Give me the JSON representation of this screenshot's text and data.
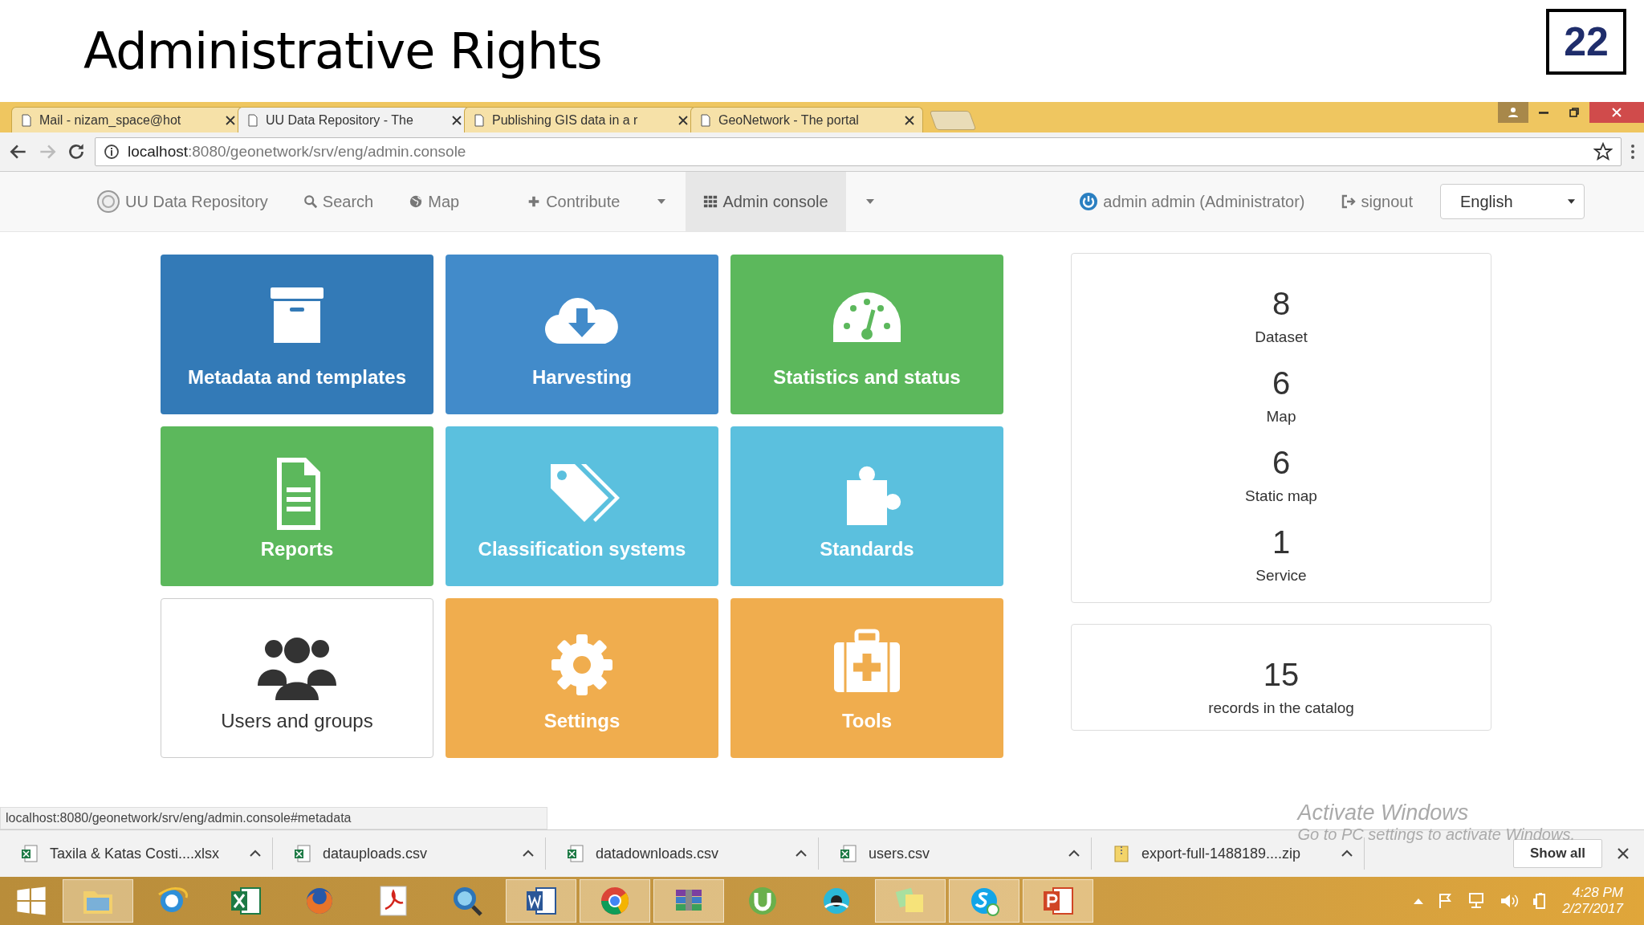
{
  "slide": {
    "title": "Administrative Rights",
    "number": "22"
  },
  "tabs": [
    {
      "label": "Mail - nizam_space@hot",
      "selected": false
    },
    {
      "label": "UU Data Repository - The",
      "selected": true
    },
    {
      "label": "Publishing GIS data in a r",
      "selected": false
    },
    {
      "label": "GeoNetwork - The portal",
      "selected": false
    }
  ],
  "address": {
    "host": "localhost",
    "path": ":8080/geonetwork/srv/eng/admin.console"
  },
  "navbar": {
    "brand": "UU Data Repository",
    "items": [
      {
        "label": "Search",
        "selected": false
      },
      {
        "label": "Map",
        "selected": false
      },
      {
        "label": "Contribute",
        "selected": false
      },
      {
        "label": "Admin console",
        "selected": true
      }
    ],
    "user": "admin admin (Administrator)",
    "signout": "signout",
    "language": "English"
  },
  "tiles": [
    {
      "label": "Metadata and templates",
      "kind": "primary"
    },
    {
      "label": "Harvesting",
      "kind": "blue"
    },
    {
      "label": "Statistics and status",
      "kind": "success"
    },
    {
      "label": "Reports",
      "kind": "success"
    },
    {
      "label": "Classification systems",
      "kind": "info"
    },
    {
      "label": "Standards",
      "kind": "info"
    },
    {
      "label": "Users and groups",
      "kind": "default"
    },
    {
      "label": "Settings",
      "kind": "warning"
    },
    {
      "label": "Tools",
      "kind": "warning"
    }
  ],
  "stats": [
    {
      "value": "8",
      "label": "Dataset"
    },
    {
      "value": "6",
      "label": "Map"
    },
    {
      "value": "6",
      "label": "Static map"
    },
    {
      "value": "1",
      "label": "Service"
    }
  ],
  "total": {
    "value": "15",
    "label": "records in the catalog"
  },
  "status_url": "localhost:8080/geonetwork/srv/eng/admin.console#metadata",
  "activation": {
    "title": "Activate Windows",
    "hint": "Go to PC settings to activate Windows."
  },
  "downloads": [
    {
      "name": "Taxila & Katas Costi....xlsx",
      "kind": "excel"
    },
    {
      "name": "datauploads.csv",
      "kind": "excel"
    },
    {
      "name": "datadownloads.csv",
      "kind": "excel"
    },
    {
      "name": "users.csv",
      "kind": "excel"
    },
    {
      "name": "export-full-1488189....zip",
      "kind": "zip"
    }
  ],
  "show_all": "Show all",
  "taskbar": {
    "items": [
      {
        "active": true
      },
      {
        "active": false
      },
      {
        "active": false
      },
      {
        "active": false
      },
      {
        "active": false
      },
      {
        "active": false
      },
      {
        "active": true
      },
      {
        "active": true
      },
      {
        "active": true
      },
      {
        "active": false
      },
      {
        "active": false
      },
      {
        "active": true
      },
      {
        "active": true
      },
      {
        "active": true
      }
    ],
    "time": "4:28 PM",
    "date": "2/27/2017"
  }
}
